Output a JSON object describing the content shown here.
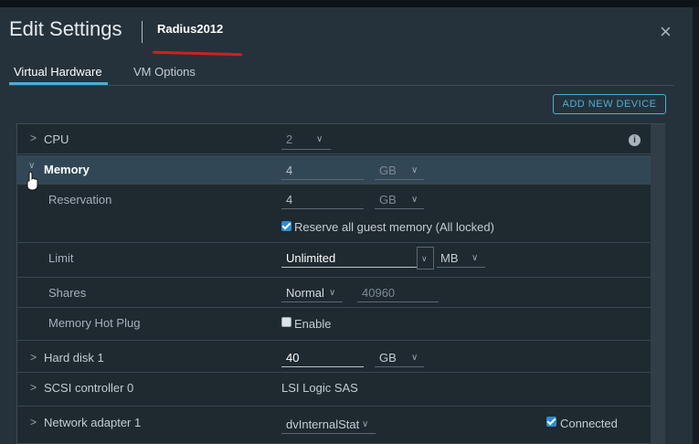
{
  "dialog": {
    "title": "Edit Settings",
    "vm_name": "Radius2012",
    "close_glyph": "×"
  },
  "tabs": [
    {
      "label": "Virtual Hardware",
      "active": true
    },
    {
      "label": "VM Options",
      "active": false
    }
  ],
  "add_device_label": "ADD NEW DEVICE",
  "hardware": {
    "cpu": {
      "label": "CPU",
      "value": "2"
    },
    "memory": {
      "label": "Memory",
      "value": "4",
      "unit": "GB",
      "expanded": true
    },
    "reservation": {
      "label": "Reservation",
      "value": "4",
      "unit": "GB"
    },
    "reserve_all": {
      "label": "Reserve all guest memory (All locked)",
      "checked": true
    },
    "limit": {
      "label": "Limit",
      "value": "Unlimited",
      "unit": "MB"
    },
    "shares": {
      "label": "Shares",
      "level": "Normal",
      "value": "40960"
    },
    "hot_plug": {
      "label": "Memory Hot Plug",
      "option": "Enable",
      "checked": false
    },
    "hard_disk": {
      "label": "Hard disk 1",
      "value": "40",
      "unit": "GB"
    },
    "scsi": {
      "label": "SCSI controller 0",
      "value": "LSI Logic SAS"
    },
    "network": {
      "label": "Network adapter 1",
      "value": "dvInternalStat",
      "connected_label": "Connected",
      "connected": true
    }
  },
  "icons": {
    "expand": "chevron-right-icon",
    "collapse": "chevron-down-icon",
    "info": "info-icon",
    "cursor": "hand-pointer-icon"
  },
  "colors": {
    "accent": "#49afd9",
    "checkbox": "#2c8cd6",
    "annotation": "#d21f1f",
    "highlight_row": "#324756"
  }
}
